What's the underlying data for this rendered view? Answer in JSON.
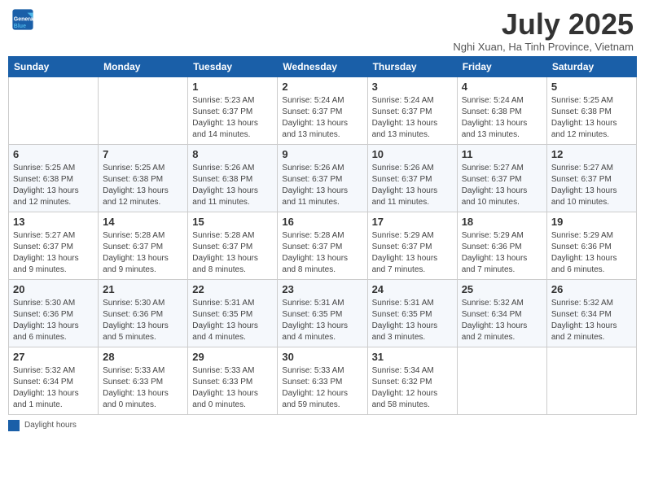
{
  "header": {
    "logo_line1": "General",
    "logo_line2": "Blue",
    "month_title": "July 2025",
    "location": "Nghi Xuan, Ha Tinh Province, Vietnam"
  },
  "days_of_week": [
    "Sunday",
    "Monday",
    "Tuesday",
    "Wednesday",
    "Thursday",
    "Friday",
    "Saturday"
  ],
  "weeks": [
    [
      {
        "day": "",
        "info": ""
      },
      {
        "day": "",
        "info": ""
      },
      {
        "day": "1",
        "info": "Sunrise: 5:23 AM\nSunset: 6:37 PM\nDaylight: 13 hours and 14 minutes."
      },
      {
        "day": "2",
        "info": "Sunrise: 5:24 AM\nSunset: 6:37 PM\nDaylight: 13 hours and 13 minutes."
      },
      {
        "day": "3",
        "info": "Sunrise: 5:24 AM\nSunset: 6:37 PM\nDaylight: 13 hours and 13 minutes."
      },
      {
        "day": "4",
        "info": "Sunrise: 5:24 AM\nSunset: 6:38 PM\nDaylight: 13 hours and 13 minutes."
      },
      {
        "day": "5",
        "info": "Sunrise: 5:25 AM\nSunset: 6:38 PM\nDaylight: 13 hours and 12 minutes."
      }
    ],
    [
      {
        "day": "6",
        "info": "Sunrise: 5:25 AM\nSunset: 6:38 PM\nDaylight: 13 hours and 12 minutes."
      },
      {
        "day": "7",
        "info": "Sunrise: 5:25 AM\nSunset: 6:38 PM\nDaylight: 13 hours and 12 minutes."
      },
      {
        "day": "8",
        "info": "Sunrise: 5:26 AM\nSunset: 6:38 PM\nDaylight: 13 hours and 11 minutes."
      },
      {
        "day": "9",
        "info": "Sunrise: 5:26 AM\nSunset: 6:37 PM\nDaylight: 13 hours and 11 minutes."
      },
      {
        "day": "10",
        "info": "Sunrise: 5:26 AM\nSunset: 6:37 PM\nDaylight: 13 hours and 11 minutes."
      },
      {
        "day": "11",
        "info": "Sunrise: 5:27 AM\nSunset: 6:37 PM\nDaylight: 13 hours and 10 minutes."
      },
      {
        "day": "12",
        "info": "Sunrise: 5:27 AM\nSunset: 6:37 PM\nDaylight: 13 hours and 10 minutes."
      }
    ],
    [
      {
        "day": "13",
        "info": "Sunrise: 5:27 AM\nSunset: 6:37 PM\nDaylight: 13 hours and 9 minutes."
      },
      {
        "day": "14",
        "info": "Sunrise: 5:28 AM\nSunset: 6:37 PM\nDaylight: 13 hours and 9 minutes."
      },
      {
        "day": "15",
        "info": "Sunrise: 5:28 AM\nSunset: 6:37 PM\nDaylight: 13 hours and 8 minutes."
      },
      {
        "day": "16",
        "info": "Sunrise: 5:28 AM\nSunset: 6:37 PM\nDaylight: 13 hours and 8 minutes."
      },
      {
        "day": "17",
        "info": "Sunrise: 5:29 AM\nSunset: 6:37 PM\nDaylight: 13 hours and 7 minutes."
      },
      {
        "day": "18",
        "info": "Sunrise: 5:29 AM\nSunset: 6:36 PM\nDaylight: 13 hours and 7 minutes."
      },
      {
        "day": "19",
        "info": "Sunrise: 5:29 AM\nSunset: 6:36 PM\nDaylight: 13 hours and 6 minutes."
      }
    ],
    [
      {
        "day": "20",
        "info": "Sunrise: 5:30 AM\nSunset: 6:36 PM\nDaylight: 13 hours and 6 minutes."
      },
      {
        "day": "21",
        "info": "Sunrise: 5:30 AM\nSunset: 6:36 PM\nDaylight: 13 hours and 5 minutes."
      },
      {
        "day": "22",
        "info": "Sunrise: 5:31 AM\nSunset: 6:35 PM\nDaylight: 13 hours and 4 minutes."
      },
      {
        "day": "23",
        "info": "Sunrise: 5:31 AM\nSunset: 6:35 PM\nDaylight: 13 hours and 4 minutes."
      },
      {
        "day": "24",
        "info": "Sunrise: 5:31 AM\nSunset: 6:35 PM\nDaylight: 13 hours and 3 minutes."
      },
      {
        "day": "25",
        "info": "Sunrise: 5:32 AM\nSunset: 6:34 PM\nDaylight: 13 hours and 2 minutes."
      },
      {
        "day": "26",
        "info": "Sunrise: 5:32 AM\nSunset: 6:34 PM\nDaylight: 13 hours and 2 minutes."
      }
    ],
    [
      {
        "day": "27",
        "info": "Sunrise: 5:32 AM\nSunset: 6:34 PM\nDaylight: 13 hours and 1 minute."
      },
      {
        "day": "28",
        "info": "Sunrise: 5:33 AM\nSunset: 6:33 PM\nDaylight: 13 hours and 0 minutes."
      },
      {
        "day": "29",
        "info": "Sunrise: 5:33 AM\nSunset: 6:33 PM\nDaylight: 13 hours and 0 minutes."
      },
      {
        "day": "30",
        "info": "Sunrise: 5:33 AM\nSunset: 6:33 PM\nDaylight: 12 hours and 59 minutes."
      },
      {
        "day": "31",
        "info": "Sunrise: 5:34 AM\nSunset: 6:32 PM\nDaylight: 12 hours and 58 minutes."
      },
      {
        "day": "",
        "info": ""
      },
      {
        "day": "",
        "info": ""
      }
    ]
  ],
  "legend": {
    "box_label": "Daylight hours"
  }
}
